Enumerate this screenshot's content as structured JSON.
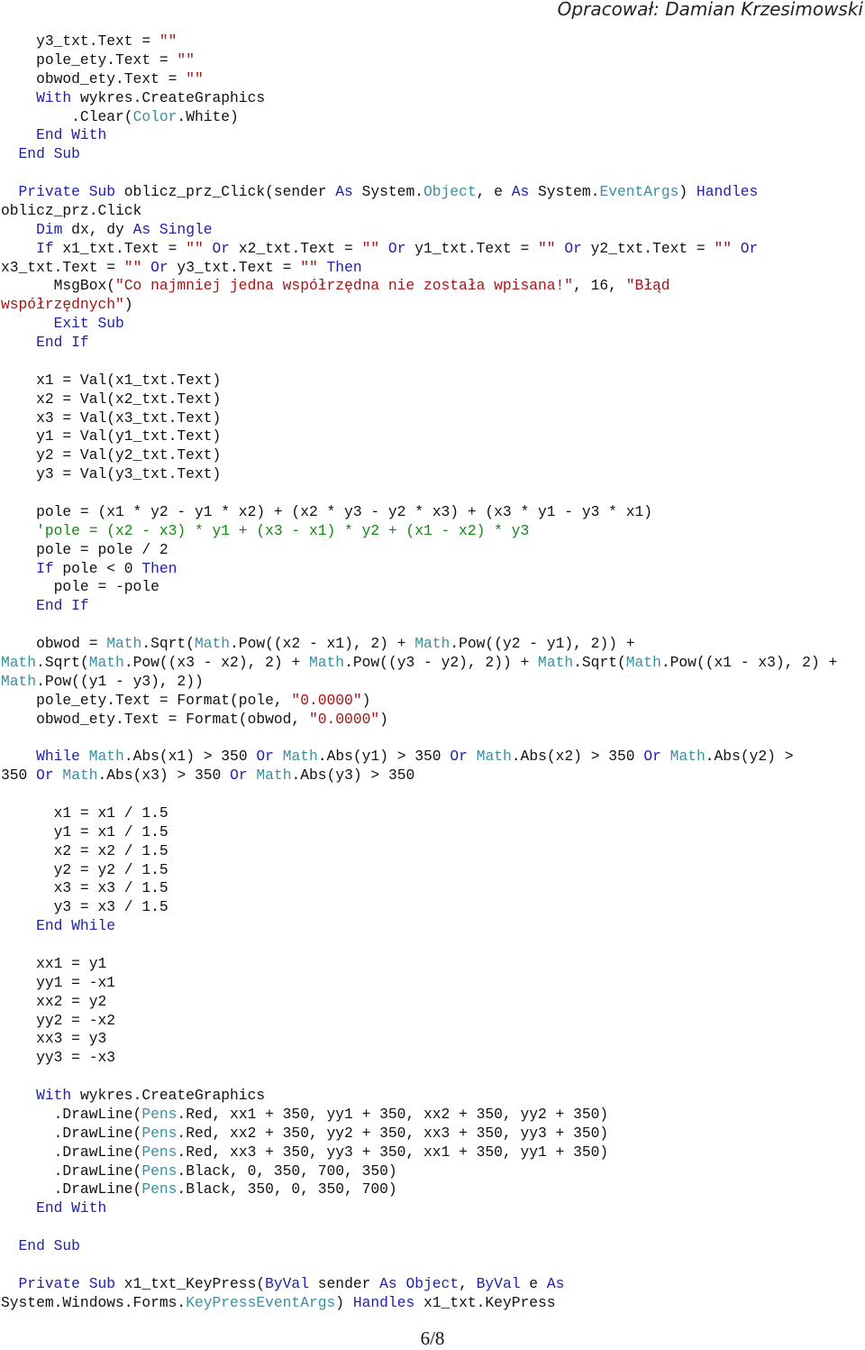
{
  "header": {
    "author": "Opracował: Damian Krzesimowski"
  },
  "footer": {
    "page": "6/8"
  },
  "code_lines": [
    [
      [
        "tx",
        "    y3_txt.Text = "
      ],
      [
        "str",
        "\"\""
      ]
    ],
    [
      [
        "tx",
        "    pole_ety.Text = "
      ],
      [
        "str",
        "\"\""
      ]
    ],
    [
      [
        "tx",
        "    obwod_ety.Text = "
      ],
      [
        "str",
        "\"\""
      ]
    ],
    [
      [
        "kw",
        "    With"
      ],
      [
        "tx",
        " wykres.CreateGraphics"
      ]
    ],
    [
      [
        "tx",
        "        .Clear("
      ],
      [
        "type",
        "Color"
      ],
      [
        "tx",
        ".White)"
      ]
    ],
    [
      [
        "kw",
        "    End With"
      ]
    ],
    [
      [
        "kw",
        "  End Sub"
      ]
    ],
    [],
    [
      [
        "kw",
        "  Private Sub"
      ],
      [
        "tx",
        " oblicz_prz_Click(sender "
      ],
      [
        "kw",
        "As"
      ],
      [
        "tx",
        " System."
      ],
      [
        "type",
        "Object"
      ],
      [
        "tx",
        ", e "
      ],
      [
        "kw",
        "As"
      ],
      [
        "tx",
        " System."
      ],
      [
        "type",
        "EventArgs"
      ],
      [
        "tx",
        ") "
      ],
      [
        "kw",
        "Handles"
      ]
    ],
    [
      [
        "tx",
        "oblicz_prz.Click"
      ]
    ],
    [
      [
        "kw",
        "    Dim"
      ],
      [
        "tx",
        " dx, dy "
      ],
      [
        "kw",
        "As Single"
      ]
    ],
    [
      [
        "kw",
        "    If"
      ],
      [
        "tx",
        " x1_txt.Text = "
      ],
      [
        "str",
        "\"\""
      ],
      [
        "kw",
        " Or"
      ],
      [
        "tx",
        " x2_txt.Text = "
      ],
      [
        "str",
        "\"\""
      ],
      [
        "kw",
        " Or"
      ],
      [
        "tx",
        " y1_txt.Text = "
      ],
      [
        "str",
        "\"\""
      ],
      [
        "kw",
        " Or"
      ],
      [
        "tx",
        " y2_txt.Text = "
      ],
      [
        "str",
        "\"\""
      ],
      [
        "kw",
        " Or"
      ]
    ],
    [
      [
        "tx",
        "x3_txt.Text = "
      ],
      [
        "str",
        "\"\""
      ],
      [
        "kw",
        " Or"
      ],
      [
        "tx",
        " y3_txt.Text = "
      ],
      [
        "str",
        "\"\""
      ],
      [
        "kw",
        " Then"
      ]
    ],
    [
      [
        "tx",
        "      MsgBox("
      ],
      [
        "str",
        "\"Co najmniej jedna współrzędna nie została wpisana!\""
      ],
      [
        "tx",
        ", 16, "
      ],
      [
        "str",
        "\"Błąd"
      ]
    ],
    [
      [
        "str",
        "współrzędnych\""
      ],
      [
        "tx",
        ")"
      ]
    ],
    [
      [
        "kw",
        "      Exit Sub"
      ]
    ],
    [
      [
        "kw",
        "    End If"
      ]
    ],
    [],
    [
      [
        "tx",
        "    x1 = Val(x1_txt.Text)"
      ]
    ],
    [
      [
        "tx",
        "    x2 = Val(x2_txt.Text)"
      ]
    ],
    [
      [
        "tx",
        "    x3 = Val(x3_txt.Text)"
      ]
    ],
    [
      [
        "tx",
        "    y1 = Val(y1_txt.Text)"
      ]
    ],
    [
      [
        "tx",
        "    y2 = Val(y2_txt.Text)"
      ]
    ],
    [
      [
        "tx",
        "    y3 = Val(y3_txt.Text)"
      ]
    ],
    [],
    [
      [
        "tx",
        "    pole = (x1 * y2 - y1 * x2) + (x2 * y3 - y2 * x3) + (x3 * y1 - y3 * x1)"
      ]
    ],
    [
      [
        "cm",
        "    'pole = (x2 - x3) * y1 + (x3 - x1) * y2 + (x1 - x2) * y3"
      ]
    ],
    [
      [
        "tx",
        "    pole = pole / 2"
      ]
    ],
    [
      [
        "kw",
        "    If"
      ],
      [
        "tx",
        " pole < 0 "
      ],
      [
        "kw",
        "Then"
      ]
    ],
    [
      [
        "tx",
        "      pole = -pole"
      ]
    ],
    [
      [
        "kw",
        "    End If"
      ]
    ],
    [],
    [
      [
        "tx",
        "    obwod = "
      ],
      [
        "type",
        "Math"
      ],
      [
        "tx",
        ".Sqrt("
      ],
      [
        "type",
        "Math"
      ],
      [
        "tx",
        ".Pow((x2 - x1), 2) + "
      ],
      [
        "type",
        "Math"
      ],
      [
        "tx",
        ".Pow((y2 - y1), 2)) +"
      ]
    ],
    [
      [
        "type",
        "Math"
      ],
      [
        "tx",
        ".Sqrt("
      ],
      [
        "type",
        "Math"
      ],
      [
        "tx",
        ".Pow((x3 - x2), 2) + "
      ],
      [
        "type",
        "Math"
      ],
      [
        "tx",
        ".Pow((y3 - y2), 2)) + "
      ],
      [
        "type",
        "Math"
      ],
      [
        "tx",
        ".Sqrt("
      ],
      [
        "type",
        "Math"
      ],
      [
        "tx",
        ".Pow((x1 - x3), 2) +"
      ]
    ],
    [
      [
        "type",
        "Math"
      ],
      [
        "tx",
        ".Pow((y1 - y3), 2))"
      ]
    ],
    [
      [
        "tx",
        "    pole_ety.Text = Format(pole, "
      ],
      [
        "str",
        "\"0.0000\""
      ],
      [
        "tx",
        ")"
      ]
    ],
    [
      [
        "tx",
        "    obwod_ety.Text = Format(obwod, "
      ],
      [
        "str",
        "\"0.0000\""
      ],
      [
        "tx",
        ")"
      ]
    ],
    [],
    [
      [
        "kw",
        "    While"
      ],
      [
        "tx",
        " "
      ],
      [
        "type",
        "Math"
      ],
      [
        "tx",
        ".Abs(x1) > 350 "
      ],
      [
        "kw",
        "Or"
      ],
      [
        "tx",
        " "
      ],
      [
        "type",
        "Math"
      ],
      [
        "tx",
        ".Abs(y1) > 350 "
      ],
      [
        "kw",
        "Or"
      ],
      [
        "tx",
        " "
      ],
      [
        "type",
        "Math"
      ],
      [
        "tx",
        ".Abs(x2) > 350 "
      ],
      [
        "kw",
        "Or"
      ],
      [
        "tx",
        " "
      ],
      [
        "type",
        "Math"
      ],
      [
        "tx",
        ".Abs(y2) >"
      ]
    ],
    [
      [
        "tx",
        "350 "
      ],
      [
        "kw",
        "Or"
      ],
      [
        "tx",
        " "
      ],
      [
        "type",
        "Math"
      ],
      [
        "tx",
        ".Abs(x3) > 350 "
      ],
      [
        "kw",
        "Or"
      ],
      [
        "tx",
        " "
      ],
      [
        "type",
        "Math"
      ],
      [
        "tx",
        ".Abs(y3) > 350"
      ]
    ],
    [],
    [
      [
        "tx",
        "      x1 = x1 / 1.5"
      ]
    ],
    [
      [
        "tx",
        "      y1 = x1 / 1.5"
      ]
    ],
    [
      [
        "tx",
        "      x2 = x2 / 1.5"
      ]
    ],
    [
      [
        "tx",
        "      y2 = y2 / 1.5"
      ]
    ],
    [
      [
        "tx",
        "      x3 = x3 / 1.5"
      ]
    ],
    [
      [
        "tx",
        "      y3 = x3 / 1.5"
      ]
    ],
    [
      [
        "kw",
        "    End While"
      ]
    ],
    [],
    [
      [
        "tx",
        "    xx1 = y1"
      ]
    ],
    [
      [
        "tx",
        "    yy1 = -x1"
      ]
    ],
    [
      [
        "tx",
        "    xx2 = y2"
      ]
    ],
    [
      [
        "tx",
        "    yy2 = -x2"
      ]
    ],
    [
      [
        "tx",
        "    xx3 = y3"
      ]
    ],
    [
      [
        "tx",
        "    yy3 = -x3"
      ]
    ],
    [],
    [
      [
        "kw",
        "    With"
      ],
      [
        "tx",
        " wykres.CreateGraphics"
      ]
    ],
    [
      [
        "tx",
        "      .DrawLine("
      ],
      [
        "type",
        "Pens"
      ],
      [
        "tx",
        ".Red, xx1 + 350, yy1 + 350, xx2 + 350, yy2 + 350)"
      ]
    ],
    [
      [
        "tx",
        "      .DrawLine("
      ],
      [
        "type",
        "Pens"
      ],
      [
        "tx",
        ".Red, xx2 + 350, yy2 + 350, xx3 + 350, yy3 + 350)"
      ]
    ],
    [
      [
        "tx",
        "      .DrawLine("
      ],
      [
        "type",
        "Pens"
      ],
      [
        "tx",
        ".Red, xx3 + 350, yy3 + 350, xx1 + 350, yy1 + 350)"
      ]
    ],
    [
      [
        "tx",
        "      .DrawLine("
      ],
      [
        "type",
        "Pens"
      ],
      [
        "tx",
        ".Black, 0, 350, 700, 350)"
      ]
    ],
    [
      [
        "tx",
        "      .DrawLine("
      ],
      [
        "type",
        "Pens"
      ],
      [
        "tx",
        ".Black, 350, 0, 350, 700)"
      ]
    ],
    [
      [
        "kw",
        "    End With"
      ]
    ],
    [],
    [
      [
        "kw",
        "  End Sub"
      ]
    ],
    [],
    [
      [
        "kw",
        "  Private Sub"
      ],
      [
        "tx",
        " x1_txt_KeyPress("
      ],
      [
        "kw",
        "ByVal"
      ],
      [
        "tx",
        " sender "
      ],
      [
        "kw",
        "As Object"
      ],
      [
        "tx",
        ", "
      ],
      [
        "kw",
        "ByVal"
      ],
      [
        "tx",
        " e "
      ],
      [
        "kw",
        "As"
      ]
    ],
    [
      [
        "tx",
        "System.Windows.Forms."
      ],
      [
        "type",
        "KeyPressEventArgs"
      ],
      [
        "tx",
        ") "
      ],
      [
        "kw",
        "Handles"
      ],
      [
        "tx",
        " x1_txt.KeyPress"
      ]
    ]
  ],
  "colors": {
    "keyword": "#1f1fa8",
    "type": "#3a8fa0",
    "string": "#a31515",
    "comment": "#118811",
    "text": "#111111"
  }
}
